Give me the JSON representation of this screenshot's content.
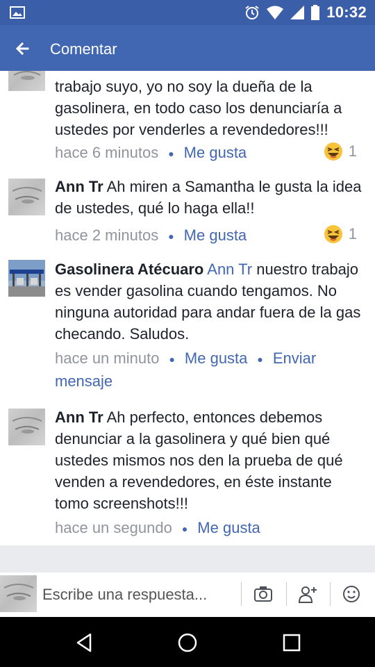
{
  "status_bar": {
    "time": "10:32"
  },
  "app_bar": {
    "title": "Comentar"
  },
  "comments": [
    {
      "text": "trabajo suyo, yo no soy la dueña de la gasolinera, en todo caso los denunciaría a ustedes por venderles a revendedores!!!",
      "time": "hace 6 minutos",
      "like_label": "Me gusta",
      "reaction_count": "1"
    },
    {
      "author": "Ann Tr",
      "text": " Ah miren a Samantha le gusta la idea de ustedes, qué lo haga ella!!",
      "time": "hace 2 minutos",
      "like_label": "Me gusta",
      "reaction_count": "1"
    },
    {
      "author": "Gasolinera Atécuaro",
      "mention": " Ann Tr",
      "text": "  nuestro trabajo es vender gasolina cuando tengamos. No ninguna autoridad para andar fuera de la gas checando. Saludos.",
      "time": "hace un minuto",
      "like_label": "Me gusta",
      "message_label": "Enviar mensaje"
    },
    {
      "author": "Ann Tr",
      "text": " Ah perfecto, entonces debemos denunciar a la gasolinera y qué bien qué ustedes mismos nos den la prueba de qué venden a revendedores, en éste instante tomo screenshots!!!",
      "time": "hace un segundo",
      "like_label": "Me gusta"
    }
  ],
  "reply_bar": {
    "placeholder": "Escribe una respuesta..."
  },
  "colors": {
    "accent": "#4267b2",
    "status_bar": "#3b5ea9",
    "meta_gray": "#90949c"
  },
  "icons": [
    "image-icon",
    "alarm-icon",
    "wifi-icon",
    "signal-icon",
    "battery-icon",
    "back-arrow-icon",
    "haha-reaction-icon",
    "camera-icon",
    "tag-friend-icon",
    "emoji-icon",
    "nav-back-icon",
    "nav-home-icon",
    "nav-recents-icon"
  ]
}
